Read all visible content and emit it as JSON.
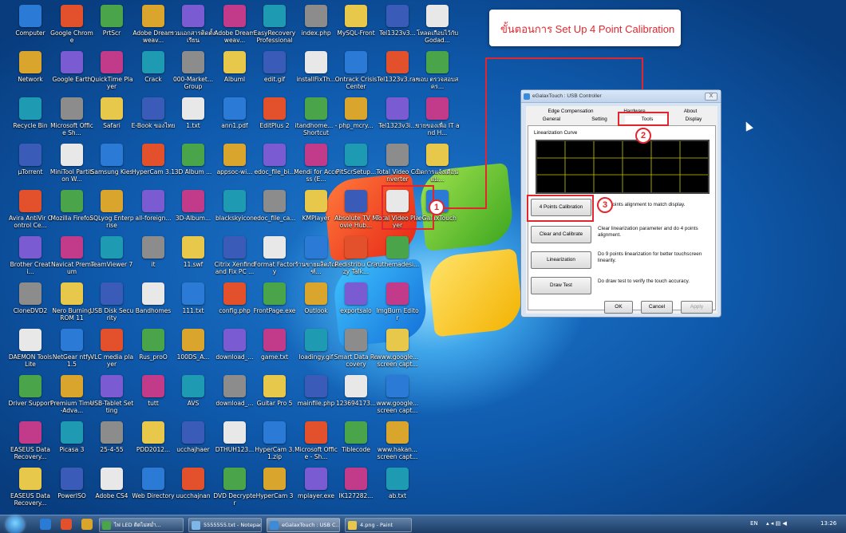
{
  "desktop_icons": [
    [
      "Computer",
      "Google Chrome",
      "PrtScr",
      "Adobe Dreamweav...",
      "รวมเอกสารติดตั้งเรียน",
      "Adobe Dreamweav...",
      "EasyRecovery Professional",
      "index.php",
      "MySQL-Front",
      "Tel1323v3...",
      "โหลดเกือบไว้กับ Godad..."
    ],
    [
      "Network",
      "Google Earth",
      "QuickTime Player",
      "Crack",
      "000-Market... Group",
      "AlbumI",
      "edit.gif",
      "installFixTh...",
      "Ontrack Crisis Center",
      "Tel1323v3.rar",
      "ขอบ ตรวจสอบสคร..."
    ],
    [
      "Recycle Bin",
      "Microsoft Office Sh...",
      "Safari",
      "E-Book ของไทย",
      "1.txt",
      "ann1.pdf",
      "EditPlus 2",
      "itandhome... - Shortcut",
      "php_mcry...",
      "Tel1323v3i...",
      "ขายของเพื่อ IT and H..."
    ],
    [
      "µTorrent",
      "MiniTool Partition W...",
      "Samsung Kies",
      "HyperCam 3.1",
      "3D Album ...",
      "appsoc-wi...",
      "edoc_file_bi...",
      "Mendi for Access (E...",
      "PitScrSetup...",
      "Total Video Converter",
      "ปิดการแจ้งเตือนแม..."
    ],
    [
      "Avira AntiVir Control Ce...",
      "Mozilla Firefox",
      "SQLyog Enterprise",
      "all-foreign...",
      "3D-Album...",
      "blackskyicon",
      "edoc_file_ca...",
      "KMPlayer",
      "Absolute TV Movie Hub...",
      "Total Video Player",
      "eGalaxTouch"
    ],
    [
      "Brother Creati...",
      "Navicat Premium",
      "TeamViewer 7",
      "it",
      "11.swf",
      "Citrix Xenfind and Fix PC ...",
      "Format Factory",
      "ร้านขายผลิตภัณฑ์...",
      "Redistribu Crazy Talk...",
      "ruthemadesi..."
    ],
    [
      "CloneDVD2",
      "Nero Burning ROM 11",
      "USB Disk Security",
      "Bandhomes",
      "111.txt",
      "config.php",
      "FrontPage.exe",
      "Outlook",
      "exportsalo",
      "ImgBurn Editor"
    ],
    [
      "DAEMON Tools Lite",
      "NetGear ntfy 1.5",
      "VLC media player",
      "Rus_proO",
      "100DS_A...",
      "download_...",
      "game.txt",
      "loadingy.gif",
      "Smart Data Recovery",
      "www.google... screen capt..."
    ],
    [
      "Driver Support",
      "Premium Time-Adva...",
      "USB-Tablet Setting",
      "tutt",
      "AVS",
      "download_...",
      "Guitar Pro 5",
      "mainfile.php",
      "123694173...",
      "www.google... screen capt..."
    ],
    [
      "EASEUS Data Recovery...",
      "Picasa 3",
      "25-4-55",
      "PDD2012...",
      "ucchajhaer",
      "DTHUH123...",
      "HyperCam 3.1.zip",
      "Microsoft Office - Sh...",
      "Tiblecode",
      "www.hakan... screen capt..."
    ],
    [
      "EASEUS Data Recovery...",
      "PowerISO",
      "Adobe CS4",
      "Web Directory",
      "uucchajnan",
      "DVD Decrypter",
      "HyperCam 3",
      "mplayer.exe",
      "IK127282...",
      "ab.txt"
    ]
  ],
  "icon_colors": [
    "#2b7bd6",
    "#e2512b",
    "#4aa54a",
    "#d9a52c",
    "#7a5bd1",
    "#c23a8a",
    "#1e9bb3",
    "#8c8c8c",
    "#e8c84a",
    "#3a5bb8",
    "#e8e8e8"
  ],
  "callout": {
    "title": "ขั้นตอนการ Set Up 4 Point Calibration"
  },
  "markers": {
    "m1": "1",
    "m2": "2",
    "m3": "3"
  },
  "dialog": {
    "title": "eGalaxTouch : USB Controller",
    "close": "X",
    "tabs_row1": [
      "Edge Compensation",
      "Hardware",
      "About"
    ],
    "tabs_row2": [
      "General",
      "Setting",
      "Tools",
      "Display"
    ],
    "curve_label": "Linearization Curve",
    "buttons": [
      {
        "label": "4 Points Calibration",
        "desc": "Do 4 points alignment to match display."
      },
      {
        "label": "Clear and Calibrate",
        "desc": "Clear linearization parameter and do 4 points alignment."
      },
      {
        "label": "Linearization",
        "desc": "Do 9 points linearization for better touchscreen linearity."
      },
      {
        "label": "Draw Test",
        "desc": "Do draw test to verify the touch accuracy."
      }
    ],
    "ok": "OK",
    "cancel": "Cancel",
    "apply": "Apply"
  },
  "taskbar": {
    "tasks": [
      "ไฟ LED ติดไม่สม่ำ...",
      "5555555.txt - Notepad",
      "eGalaxTouch : USB C...",
      "4.png - Paint"
    ],
    "lang": "EN",
    "clock": "13:26"
  }
}
